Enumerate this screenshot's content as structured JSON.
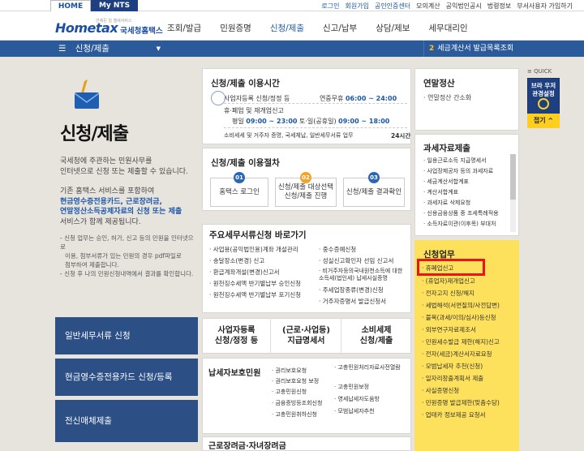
{
  "topbar": {
    "tabs": [
      "HOME",
      "My NTS"
    ],
    "links": [
      "로그인",
      "회원가입",
      "공인인증센터",
      "모의계산",
      "공익법인공시",
      "법령정보",
      "부서사용자 가입하기"
    ]
  },
  "header": {
    "logo": "Hometax",
    "logo_sub": "국세청홈택스",
    "logo_tagline": "언제든 일 열세서비스",
    "gnb": [
      "조회/발급",
      "민원증명",
      "신청/제출",
      "신고/납부",
      "상담/제보",
      "세무대리인"
    ]
  },
  "subnav": {
    "menu": "신청/제출",
    "right_num": "2",
    "right_text": "세금계산서 발급목록조회"
  },
  "left": {
    "title": "신청/제출",
    "intro": [
      "국세청에 주관하는 민원사무를",
      "인터넷으로 신청 또는 제출할 수 있습니다."
    ],
    "intro2_pre": "기존 홈택스 서비스를 포함하여",
    "intro2_bold": [
      "현금영수증전용카드, 근로장려금,",
      "연말정산소득공제자료의 신청 또는 제출"
    ],
    "intro2_post": "서비스가 함께 제공됩니다.",
    "notes": [
      "- 신청 업무는 승인, 허가, 신고 등의 민원을 인터넷으로",
      "이용, 첨부서류가 있는 민원의 경우 pdf파일로",
      "첨부하여 제출합니다.",
      "- 신청 후 나의 민원신청내역에서 결과를 확인합니다."
    ],
    "buttons": [
      "일반세무서류 신청",
      "현금영수증전용카드 신청/등록",
      "전신매체제출"
    ]
  },
  "hours": {
    "title": "신청/제출 이용시간",
    "r1_label": "사업자등록 신청/정정 등",
    "r1_prefix": "연중무휴",
    "r1_time": "06:00 ~ 24:00",
    "r2_label": "휴·폐업 및 재개업신고",
    "r3_prefix": "평일",
    "r3_time1": "09:00 ~ 23:00",
    "r3_mid": "토·일(공휴일)",
    "r3_time2": "09:00 ~ 18:00",
    "r4_label": "소비세세 및 거주자 증명, 국세체납, 일반세무서류 업무",
    "r4_value": "24시간"
  },
  "procedure": {
    "title": "신청/제출 이용절차",
    "steps": [
      {
        "num": "01",
        "label": "홈택스 로그인"
      },
      {
        "num": "02",
        "label": "신청/제출 대상선택 신청/제출 진행"
      },
      {
        "num": "03",
        "label": "신청/제출 결과확인"
      }
    ]
  },
  "quicklinks": {
    "title": "주요세무서류신청 바로가기",
    "left": [
      "사업용(공익법인용)계좌 개설관리",
      "송달장소(변경) 신고",
      "환급계좌개설(변경)신고서",
      "원천징수세액 반기별납부 승인신청",
      "원천징수세액 반기별납부 포기신청"
    ],
    "right": [
      "중수증예신청",
      "성실신고확인자 선임 신고서",
      "비거주자등의국내원천소득에 대한 소득세(법인세) 납세사실증명",
      "주세업장종류(변경)신청",
      "거주자증명서 발급신청서"
    ]
  },
  "action_boxes": [
    {
      "line1": "사업자등록",
      "line2": "신청/정정 등"
    },
    {
      "line1": "(근로·사업등)",
      "line2": "지급명세서"
    },
    {
      "line1": "소비세제",
      "line2": "신청/제출"
    }
  ],
  "taxpayer": {
    "title": "납세자보호민원",
    "col1": [
      "권리보호요청",
      "권리보호요청 보정",
      "고충민원신청",
      "금융증빙등조회신청",
      "고충민원취하신청"
    ],
    "col2": [
      "고충민원처리자료사전열람",
      "고충민원보정",
      "영세납세자도움방",
      "모범납세자추천"
    ]
  },
  "bottom_card": {
    "title": "근로장려금·자녀장려금"
  },
  "yearend": {
    "title": "연말정산",
    "item": "연말정산 간소화"
  },
  "taxdata": {
    "title": "과세자료제출",
    "items": [
      "일용근로소득 지급명세서",
      "사업장제공자 등의 과세자료",
      "세금계산서합계표",
      "계산서합계표",
      "과세자료 삭제요청",
      "신용금융상품 중 조세특례적용",
      "소득자료이관(이후목) 부대처"
    ]
  },
  "application": {
    "title": "신청업무",
    "items": [
      "휴폐업신고",
      "(휴업자)재개업신고",
      "전자고지 신청/해지",
      "세법해석(서면질의/사전답변)",
      "불복(과세/이의/심사)등신청",
      "외부연구자료제조서",
      "민원세수발급 제한(해지)신고",
      "전자(세금)계산서자료요청",
      "모범납세자 추천(신청)",
      "일자리창출계획서 제출",
      "사실증명신청",
      "민원증명 발급제한(맞춤수당)",
      "업태카 정보제공 요청서"
    ]
  },
  "quick": {
    "label": "QUICK",
    "text": "브라 우저 관경설정",
    "btn": "접기"
  }
}
